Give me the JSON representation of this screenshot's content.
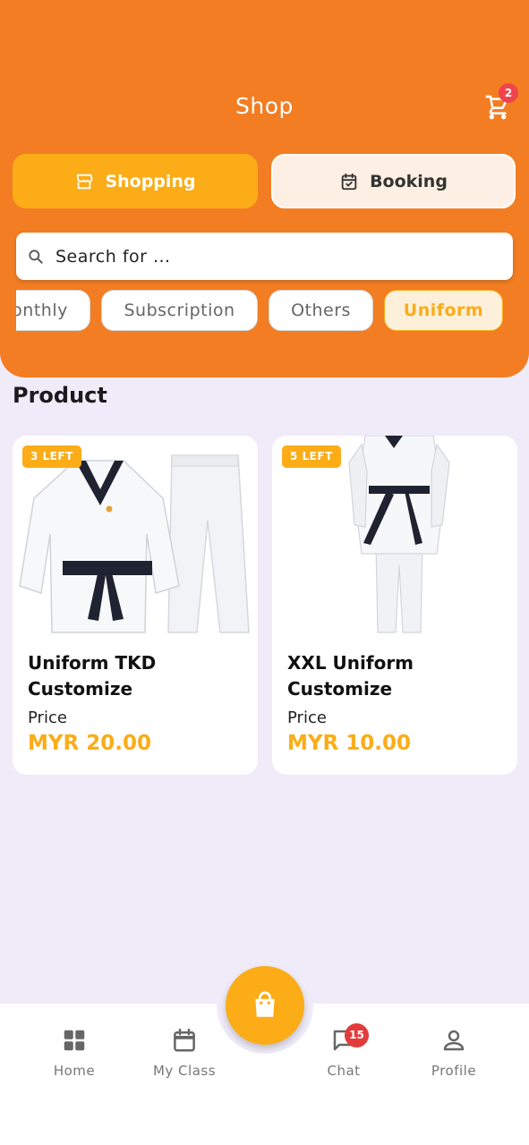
{
  "header": {
    "title": "Shop",
    "cart_count": "2"
  },
  "tabs": {
    "shopping": "Shopping",
    "booking": "Booking",
    "active": "Shopping"
  },
  "search": {
    "placeholder": "Search for ..."
  },
  "categories": [
    {
      "label": "onthly",
      "active": false
    },
    {
      "label": "Subscription",
      "active": false
    },
    {
      "label": "Others",
      "active": false
    },
    {
      "label": "Uniform",
      "active": true
    }
  ],
  "section": {
    "title": "Product"
  },
  "products": [
    {
      "stock": "3 LEFT",
      "name": "Uniform TKD Customize",
      "price_label": "Price",
      "price": "MYR 20.00"
    },
    {
      "stock": "5 LEFT",
      "name": "XXL Uniform Customize",
      "price_label": "Price",
      "price": "MYR 10.00"
    }
  ],
  "nav": {
    "items": [
      {
        "label": "Home",
        "icon": "grid-icon"
      },
      {
        "label": "My Class",
        "icon": "calendar-icon"
      },
      {
        "label": "Chat",
        "icon": "chat-icon",
        "badge": "15"
      },
      {
        "label": "Profile",
        "icon": "person-icon"
      }
    ],
    "fab_icon": "shopping-bag-icon"
  },
  "colors": {
    "header": "#f27d23",
    "accent": "#fbac17",
    "background": "#efebf8",
    "badge": "#f0444c"
  }
}
